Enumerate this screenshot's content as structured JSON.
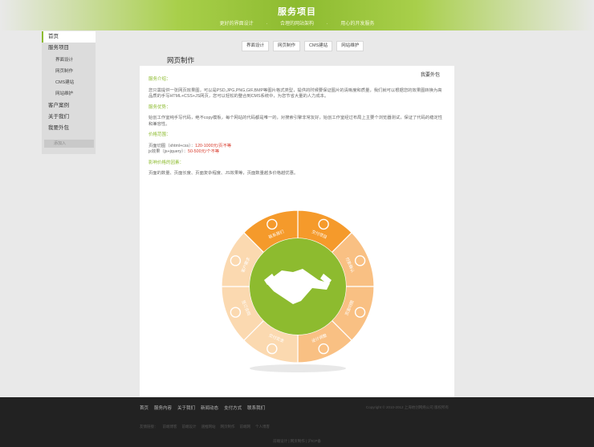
{
  "hero": {
    "title": "服务项目",
    "subtitle": "更好的界面设计 · 合理的网站架构 · 用心的开发服务"
  },
  "sidebar": {
    "items": [
      {
        "label": "首页"
      },
      {
        "label": "服务项目"
      },
      {
        "label": "界面设计"
      },
      {
        "label": "网页制作"
      },
      {
        "label": "CMS建站"
      },
      {
        "label": "网站维护"
      },
      {
        "label": "客户案例"
      },
      {
        "label": "关于我们"
      },
      {
        "label": "我要外包"
      }
    ],
    "button_label": "添加入"
  },
  "tabs": [
    "界面设计",
    "网页制作",
    "CMS建站",
    "网站维护"
  ],
  "page": {
    "title": "网页制作",
    "top_right": "我要外包"
  },
  "content": {
    "intro_heading": "服务介绍：",
    "intro_text": "您只需提供一张网页效果图，可以是PSD,JPG,PNG,GIF,BMP等图片格式类型，提供的时候要保证图片的清晰度和质量，我们就可以根据您的效果图转换为高品质的手写HTML+CSS+JS网页，您可以轻松的整合到CMS系统中，为您节省大量的人力成本。",
    "advantage_heading": "服务优势：",
    "advantage_text": "始创工作室纯手写代码，绝不copy模板，每个网站的代码都是唯一的，对搜索引擎非常友好，始创工作室经过布局上主要个浏览器测试，保证了代码的稳定性和兼容性。",
    "price_heading": "价格范围：",
    "price_line1_label": "页面切图（xhtml+css）：",
    "price_line1_value": "120-1000元/页不等",
    "price_line2_label": "js效果（js+jquery）：",
    "price_line2_value": "50-500元/个不等",
    "factors_heading": "影响价格的因素：",
    "factors_text": "页面的数量、页面长度、页面复杂程度、JS效果等，页面数量越多价格越优惠。"
  },
  "wheel": {
    "segments": [
      "交付项目",
      "付款确认",
      "页面切图",
      "设计调整",
      "交付定金",
      "签订合同",
      "客户需求",
      "联系我们"
    ]
  },
  "colors": {
    "accent_green": "#8dbb2f",
    "orange": "#f59a2b",
    "light_orange": "#f9c083",
    "pale_orange": "#fbd9b0",
    "price_red": "#d8392a",
    "footer_bg": "#222222"
  },
  "footer": {
    "nav": [
      "首页",
      "服务内容",
      "关于我们",
      "新闻动态",
      "支付方式",
      "联系我们"
    ],
    "copyright": "Copyright © 2010-2012 上海始创网络公司 版权所有",
    "links_label": "友情链接：",
    "links": [
      "前端博客",
      "前端设计",
      "速推网站",
      "网页制作",
      "前端网",
      "个人博客"
    ],
    "bottom": "前端设计 | 网页制作 | 沪ICP备"
  }
}
